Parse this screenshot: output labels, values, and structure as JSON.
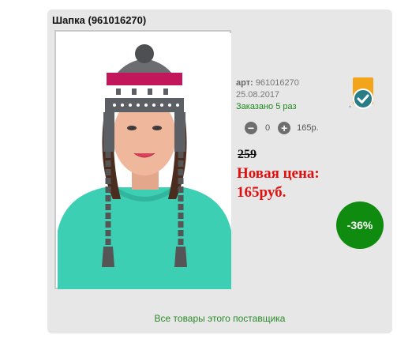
{
  "product": {
    "title": "Шапка (961016270)",
    "article_label": "арт:",
    "article_value": "961016270",
    "date": "25.08.2017",
    "ordered": "Заказано 5 раз"
  },
  "quantity": {
    "minus": "−",
    "value": "0",
    "plus": "+",
    "price": "165р."
  },
  "pricing": {
    "old_price": "259",
    "new_price_label": "Новая цена:",
    "new_price_value": "165руб.",
    "discount": "-36%"
  },
  "badge": {
    "mark": ","
  },
  "footer": {
    "supplier_link": "Все товары этого поставщика"
  },
  "colors": {
    "panel": "#e7e7e7",
    "accent_green": "#0f8c0f",
    "price_red": "#e01010",
    "badge_orange": "#f2a51b",
    "badge_teal": "#2a7d86"
  }
}
